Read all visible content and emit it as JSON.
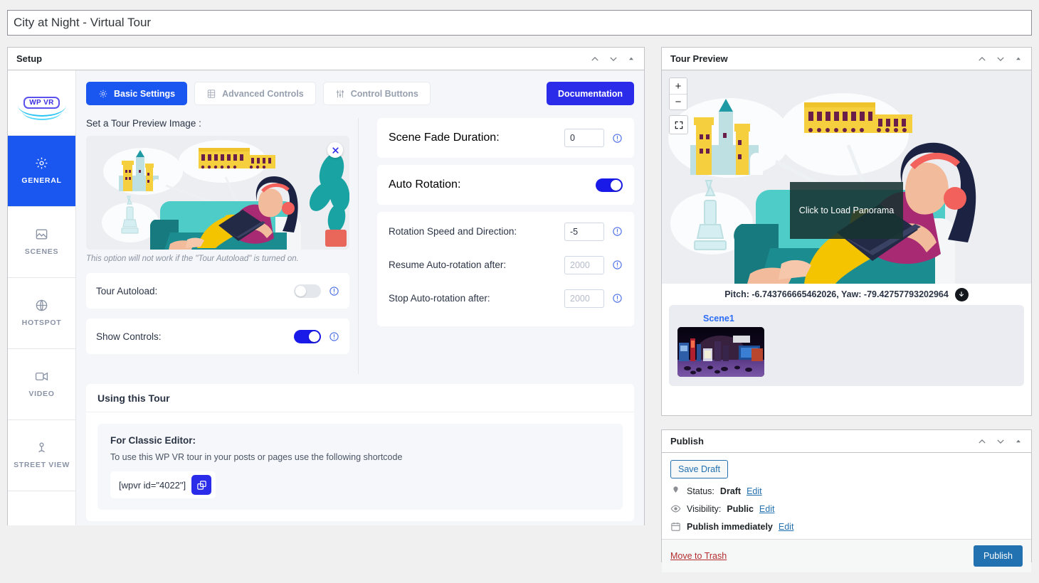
{
  "title_input": {
    "value": "City at Night - Virtual Tour"
  },
  "setup_panel": {
    "title": "Setup"
  },
  "sidebar": {
    "logo": "WP VR",
    "items": [
      {
        "label": "GENERAL",
        "icon": "gear-icon",
        "active": true
      },
      {
        "label": "SCENES",
        "icon": "image-icon",
        "active": false
      },
      {
        "label": "HOTSPOT",
        "icon": "globe-icon",
        "active": false
      },
      {
        "label": "VIDEO",
        "icon": "video-icon",
        "active": false
      },
      {
        "label": "STREET VIEW",
        "icon": "street-view-icon",
        "active": false
      }
    ]
  },
  "tabs": [
    {
      "label": "Basic Settings",
      "icon": "gear-icon",
      "active": true
    },
    {
      "label": "Advanced Controls",
      "icon": "sliders-grid-icon",
      "active": false
    },
    {
      "label": "Control Buttons",
      "icon": "equalizer-icon",
      "active": false
    }
  ],
  "documentation_button": "Documentation",
  "basic_settings": {
    "preview_image_label": "Set a Tour Preview Image :",
    "preview_hint": "This option will not work if the \"Tour Autoload\" is turned on.",
    "tour_autoload": {
      "label": "Tour Autoload:",
      "state": "off"
    },
    "show_controls": {
      "label": "Show Controls:",
      "state": "on"
    },
    "scene_fade_duration": {
      "label": "Scene Fade Duration:",
      "value": "0",
      "placeholder": ""
    },
    "auto_rotation": {
      "label": "Auto Rotation:",
      "state": "on"
    },
    "rotation_speed": {
      "label": "Rotation Speed and Direction:",
      "value": "-5",
      "placeholder": ""
    },
    "resume_auto_rotation": {
      "label": "Resume Auto-rotation after:",
      "value": "",
      "placeholder": "2000"
    },
    "stop_auto_rotation": {
      "label": "Stop Auto-rotation after:",
      "value": "",
      "placeholder": "2000"
    }
  },
  "using_tour": {
    "heading": "Using this Tour",
    "classic_editor_title": "For Classic Editor:",
    "classic_editor_desc": "To use this WP VR tour in your posts or pages use the following shortcode",
    "shortcode": "[wpvr id=\"4022\"]",
    "copy_icon": "copy-icon"
  },
  "tour_preview": {
    "title": "Tour Preview",
    "zoom_in": "+",
    "zoom_out": "−",
    "fullscreen_icon": "fullscreen-icon",
    "load_overlay": "Click to Load Panorama",
    "pitch_yaw": "Pitch: -6.743766665462026, Yaw: -79.42757793202964",
    "download_icon": "download-icon",
    "scenes": [
      {
        "name": "Scene1"
      }
    ]
  },
  "publish": {
    "title": "Publish",
    "save_draft": "Save Draft",
    "status_label": "Status:",
    "status_value": "Draft",
    "visibility_label": "Visibility:",
    "visibility_value": "Public",
    "schedule_text": "Publish immediately",
    "edit_label": "Edit",
    "move_to_trash": "Move to Trash",
    "publish_button": "Publish"
  },
  "colors": {
    "accent_blue": "#1a56f0",
    "doc_blue": "#2b2bea",
    "wp_blue": "#2271b1",
    "trash_red": "#b32d2e",
    "toggle_on": "#1a1ae8"
  }
}
